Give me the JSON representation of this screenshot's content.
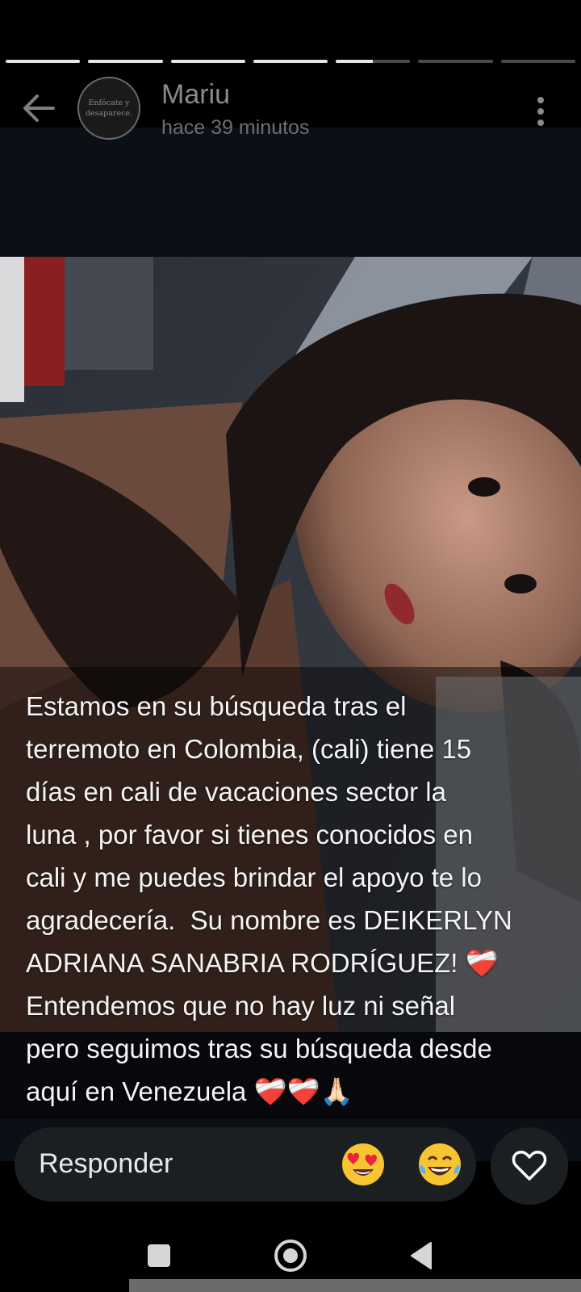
{
  "progress": {
    "segments": [
      1,
      1,
      1,
      1,
      0.5,
      0,
      0
    ]
  },
  "header": {
    "avatar_text": "Enfócate y desaparece.",
    "user_name": "Mariu",
    "time_ago": "hace 39 minutos"
  },
  "story": {
    "caption": "Estamos en su búsqueda tras el\nterremoto en Colombia, (cali) tiene 15\ndías en cali de vacaciones sector la\nluna , por favor si tienes conocidos en\ncali y me puedes brindar el apoyo te lo\nagradecería.  Su nombre es DEIKERLYN\nADRIANA SANABRIA RODRÍGUEZ! ❤️‍🩹\nEntendemos que no hay luz ni señal\npero seguimos tras su búsqueda desde\naquí en Venezuela ❤️‍🩹❤️‍🩹🙏🏻"
  },
  "reply": {
    "placeholder": "Responder",
    "quick_emojis": [
      "heart-eyes-emoji",
      "joy-emoji"
    ]
  },
  "colors": {
    "background": "#000000",
    "reply_box": "#1c1f21",
    "text": "#ffffff"
  }
}
